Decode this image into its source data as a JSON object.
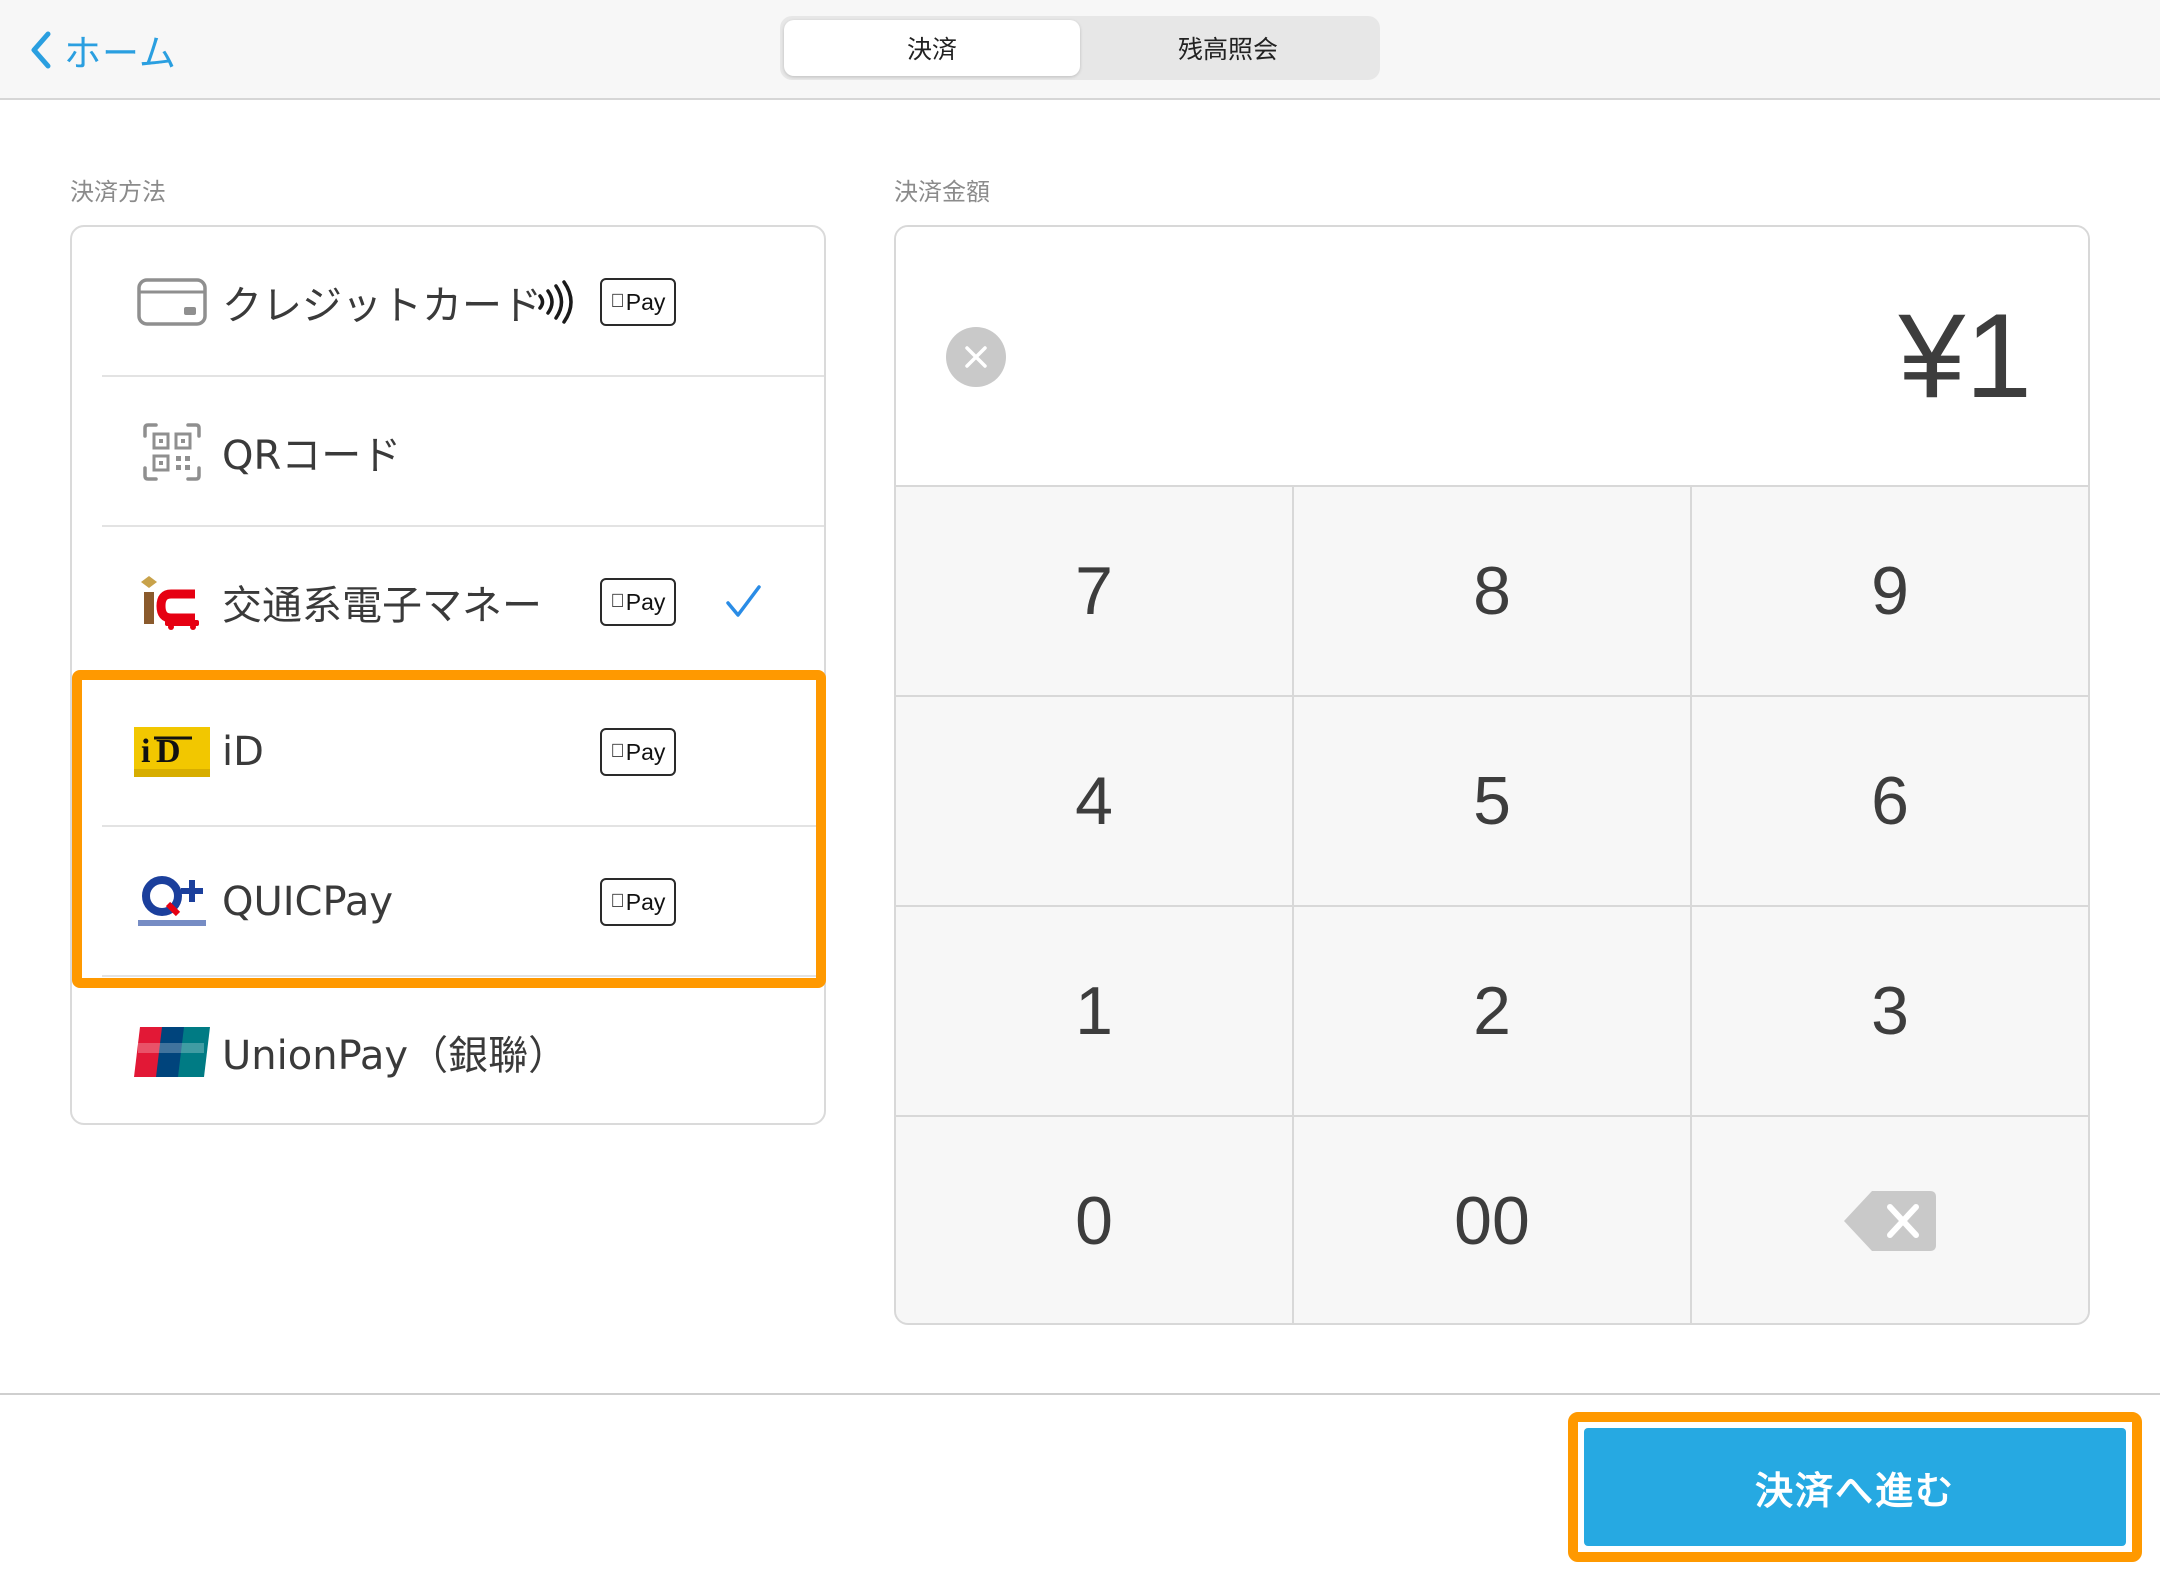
{
  "header": {
    "back_label": "ホーム",
    "tabs": [
      {
        "label": "決済",
        "active": true
      },
      {
        "label": "残高照会",
        "active": false
      }
    ]
  },
  "methods": {
    "section_label": "決済方法",
    "apple_pay_label": "Pay",
    "items": [
      {
        "label": "クレジットカード",
        "icon": "credit-card-icon",
        "contactless": true,
        "apple_pay": true,
        "selected": false
      },
      {
        "label": "QRコード",
        "icon": "qr-code-icon",
        "contactless": false,
        "apple_pay": false,
        "selected": false
      },
      {
        "label": "交通系電子マネー",
        "icon": "transit-ic-icon",
        "contactless": false,
        "apple_pay": true,
        "selected": true
      },
      {
        "label": "iD",
        "icon": "id-logo-icon",
        "contactless": false,
        "apple_pay": true,
        "selected": false
      },
      {
        "label": "QUICPay",
        "icon": "quicpay-logo-icon",
        "contactless": false,
        "apple_pay": true,
        "selected": false
      },
      {
        "label": "UnionPay（銀聯）",
        "icon": "unionpay-logo-icon",
        "contactless": false,
        "apple_pay": false,
        "selected": false
      }
    ]
  },
  "amount": {
    "section_label": "決済金額",
    "value": "¥1"
  },
  "keypad": {
    "keys": [
      "7",
      "8",
      "9",
      "4",
      "5",
      "6",
      "1",
      "2",
      "3",
      "0",
      "00"
    ]
  },
  "footer": {
    "proceed_label": "決済へ進む"
  },
  "colors": {
    "accent": "#26a9e2",
    "highlight": "#ff9900",
    "link": "#2a9fe0"
  }
}
